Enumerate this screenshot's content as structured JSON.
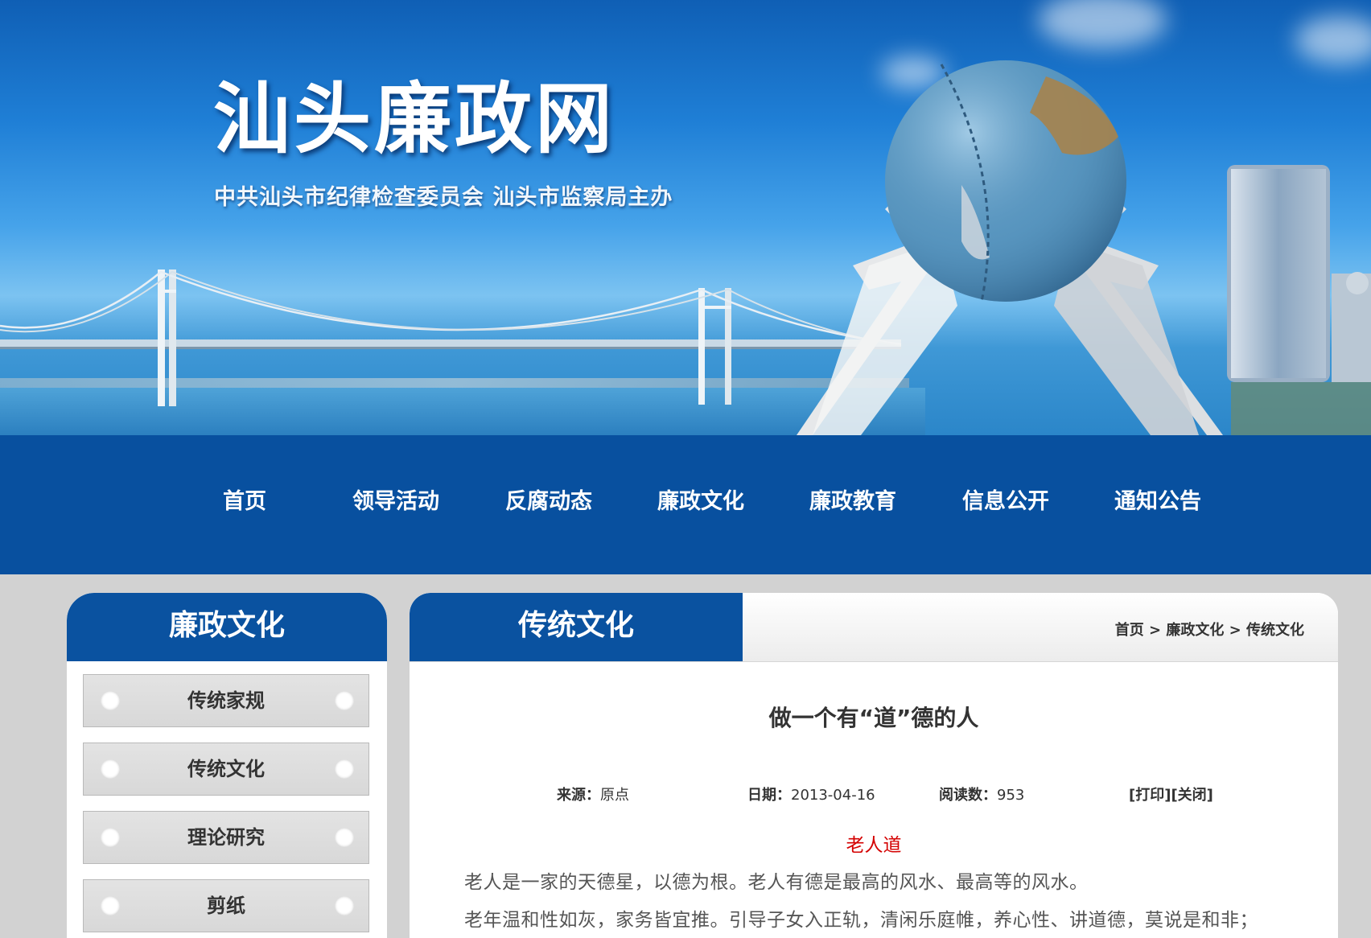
{
  "banner": {
    "title": "汕头廉政网",
    "subtitle": "中共汕头市纪律检查委员会  汕头市监察局主办"
  },
  "nav": {
    "items": [
      "首页",
      "领导活动",
      "反腐动态",
      "廉政文化",
      "廉政教育",
      "信息公开",
      "通知公告"
    ]
  },
  "sidebar": {
    "heading": "廉政文化",
    "items": [
      "传统家规",
      "传统文化",
      "理论研究",
      "剪纸"
    ]
  },
  "main": {
    "tab_title": "传统文化",
    "breadcrumb": {
      "home": "首页",
      "sep1": " > ",
      "section": "廉政文化",
      "sep2": " > ",
      "current": "传统文化"
    },
    "article": {
      "title": "做一个有“道”德的人",
      "source_label": "来源：",
      "source_value": "原点",
      "date_label": "日期：",
      "date_value": "2013-04-16",
      "reads_label": "阅读数：",
      "reads_value": "953",
      "print": "[打印]",
      "close": "[关闭]",
      "section_heading": "老人道",
      "paragraphs": [
        "老人是一家的天德星，以德为根。老人有德是最高的风水、最高等的风水。",
        "老年温和性如灰，家务皆宜推。引导子女入正轨，清闲乐庭帷，养心性、讲道德，莫说是和非；"
      ]
    }
  },
  "colors": {
    "nav_bg": "#08509f",
    "heading_bg": "#0a52a0",
    "page_bg": "#d2d2d2",
    "accent_red": "#d40000"
  }
}
